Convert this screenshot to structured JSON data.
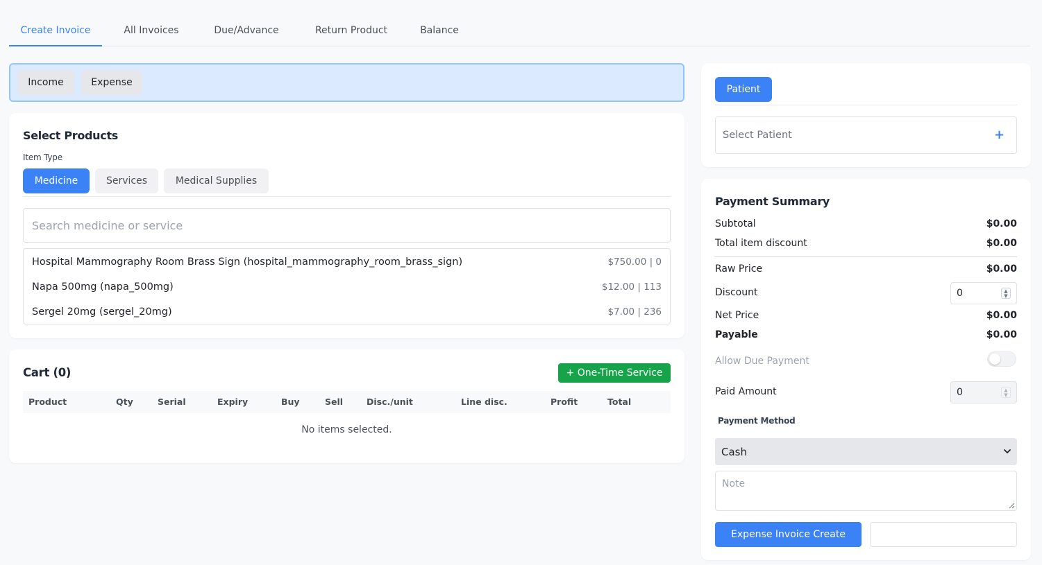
{
  "tabs": [
    "Create Invoice",
    "All Invoices",
    "Due/Advance",
    "Return Product",
    "Balance"
  ],
  "invoice_type": {
    "income": "Income",
    "expense": "Expense"
  },
  "products": {
    "title": "Select Products",
    "item_type_label": "Item Type",
    "types": [
      "Medicine",
      "Services",
      "Medical Supplies"
    ],
    "active_type": "Medicine",
    "search_placeholder": "Search medicine or service",
    "results": [
      {
        "name": "Hospital Mammography Room Brass Sign (hospital_mammography_room_brass_sign)",
        "meta": "$750.00 | 0"
      },
      {
        "name": "Napa 500mg (napa_500mg)",
        "meta": "$12.00 | 113"
      },
      {
        "name": "Sergel 20mg (sergel_20mg)",
        "meta": "$7.00 | 236"
      }
    ]
  },
  "cart": {
    "title": "Cart (0)",
    "one_time_button": "+ One-Time Service",
    "columns": [
      "Product",
      "Qty",
      "Serial",
      "Expiry",
      "Buy",
      "Sell",
      "Disc./unit",
      "Line disc.",
      "Profit",
      "Total"
    ],
    "empty_text": "No items selected."
  },
  "patient": {
    "tab_label": "Patient",
    "select_placeholder": "Select Patient",
    "add_symbol": "+"
  },
  "summary": {
    "title": "Payment Summary",
    "subtotal_label": "Subtotal",
    "subtotal": "$0.00",
    "item_discount_label": "Total item discount",
    "item_discount": "$0.00",
    "raw_price_label": "Raw Price",
    "raw_price": "$0.00",
    "discount_label": "Discount",
    "discount_value": "0",
    "net_price_label": "Net Price",
    "net_price": "$0.00",
    "payable_label": "Payable",
    "payable": "$0.00",
    "allow_due_label": "Allow Due Payment",
    "allow_due_enabled": false,
    "paid_amount_label": "Paid Amount",
    "paid_amount": "0",
    "payment_method_label": "Payment Method",
    "payment_method": "Cash",
    "note_placeholder": "Note",
    "create_button": "Expense Invoice Create"
  },
  "colors": {
    "accent": "#3b82f6",
    "success": "#16a34a",
    "highlight_bg": "#dbeafe"
  },
  "icons": {
    "spinner": "number-spinner-icon",
    "dropdown": "chevron-down-icon",
    "add": "plus-icon",
    "resize": "resize-grip-icon"
  }
}
